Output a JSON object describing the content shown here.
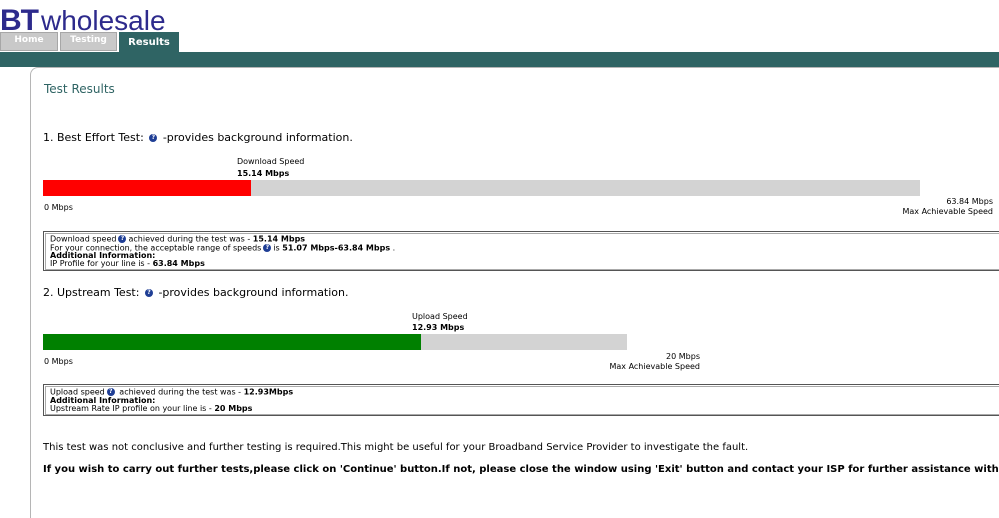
{
  "logo": {
    "bt": "BT",
    "wholesale": "wholesale"
  },
  "tabs": [
    {
      "label": "Home",
      "active": false
    },
    {
      "label": "Testing",
      "active": false
    },
    {
      "label": "Results",
      "active": true
    }
  ],
  "colors": {
    "band": "#2f6464",
    "download_bar": "#ff0000",
    "upload_bar": "#008000",
    "track": "#d3d3d3"
  },
  "page_title": "Test Results",
  "best_effort": {
    "heading_prefix": "1. Best Effort Test:",
    "heading_suffix": "-provides background information.",
    "speed_label": "Download Speed",
    "speed_value": "15.14 Mbps",
    "measured_mbps": 15.14,
    "max_mbps": 63.84,
    "min_label": "0 Mbps",
    "max_value": "63.84 Mbps",
    "max_label": "Max Achievable Speed",
    "info": {
      "line1_a": "Download speed",
      "line1_b": "achieved during the test was - ",
      "line1_value": "15.14 Mbps",
      "line2_a": "For your connection, the acceptable range of speeds",
      "line2_b": "is ",
      "line2_value": "51.07 Mbps-63.84 Mbps",
      "line2_end": " .",
      "additional": "Additional Information:",
      "line4_a": "IP Profile for your line is - ",
      "line4_value": "63.84 Mbps"
    }
  },
  "upstream": {
    "heading_prefix": "2. Upstream Test:",
    "heading_suffix": "-provides background information.",
    "speed_label": "Upload Speed",
    "speed_value": "12.93 Mbps",
    "measured_mbps": 12.93,
    "max_mbps": 20,
    "min_label": "0 Mbps",
    "max_value": "20 Mbps",
    "max_label": "Max Achievable Speed",
    "info": {
      "line1_a": "Upload speed",
      "line1_b": " achieved during the test was - ",
      "line1_value": "12.93Mbps",
      "additional": "Additional Information:",
      "line3_a": "Upstream Rate IP profile on your line is - ",
      "line3_value": "20 Mbps"
    }
  },
  "notice": "This test was not conclusive and further testing is required.This might be useful for your Broadband Service Provider to investigate the fault.",
  "notice_bold": "If you wish to carry out further tests,please click on 'Continue' button.If not, please close the window using 'Exit' button and contact your ISP for further assistance with these"
}
